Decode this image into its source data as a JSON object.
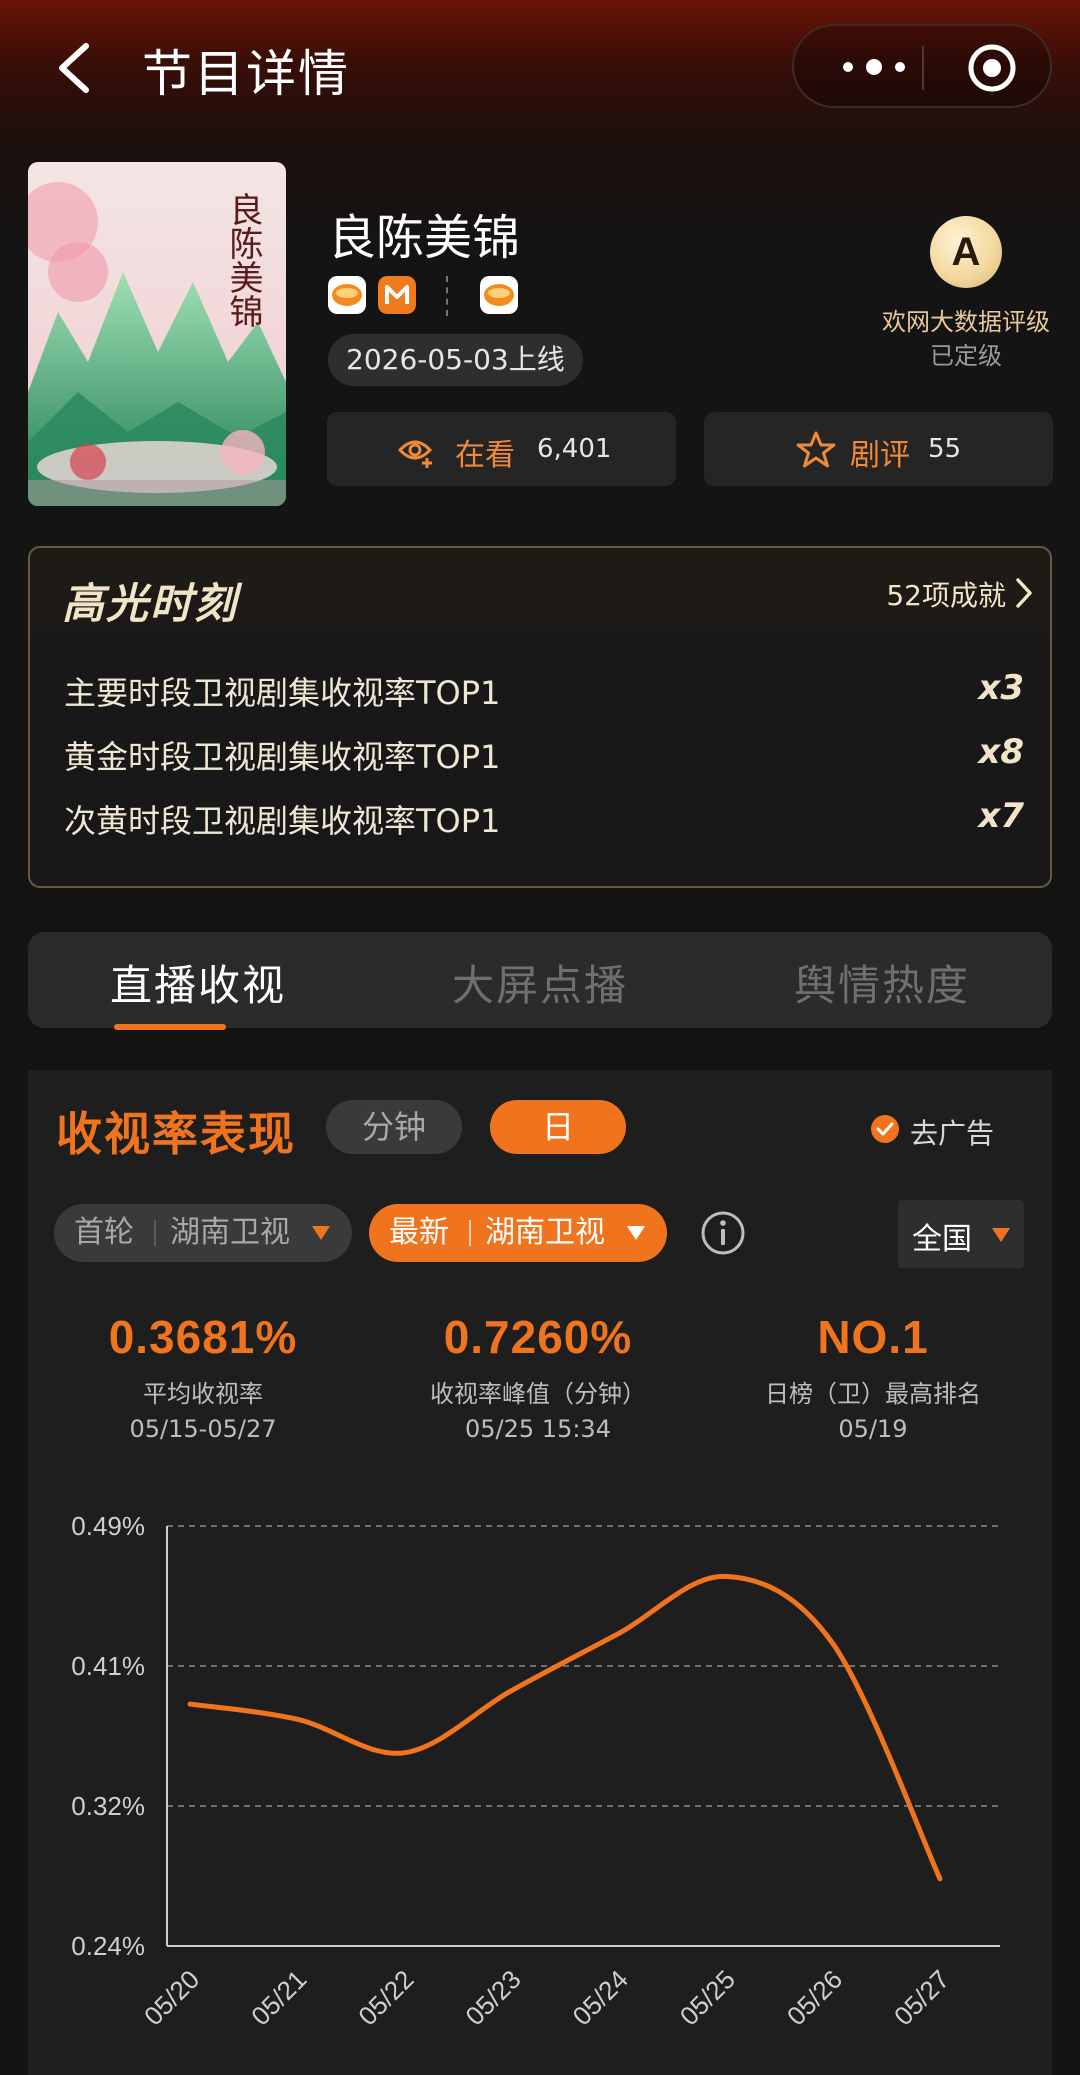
{
  "header": {
    "title": "节目详情"
  },
  "show": {
    "title": "良陈美锦",
    "release": "2026-05-03上线",
    "poster_text": "良陈美锦",
    "rating": {
      "grade": "A",
      "label": "欢网大数据评级",
      "status": "已定级"
    },
    "watching": {
      "label": "在看",
      "count": "6,401"
    },
    "reviews": {
      "label": "剧评",
      "count": "55"
    }
  },
  "highlights": {
    "title": "高光时刻",
    "count": "52项成就",
    "items": [
      {
        "text": "主要时段卫视剧集收视率TOP1",
        "times": "x3"
      },
      {
        "text": "黄金时段卫视剧集收视率TOP1",
        "times": "x8"
      },
      {
        "text": "次黄时段卫视剧集收视率TOP1",
        "times": "x7"
      }
    ]
  },
  "tabs": [
    "直播收视",
    "大屏点播",
    "舆情热度"
  ],
  "section": {
    "title": "收视率表现",
    "seg_minute": "分钟",
    "seg_day": "日",
    "ad_free": "去广告",
    "filter_first": {
      "a": "首轮",
      "b": "湖南卫视"
    },
    "filter_latest": {
      "a": "最新",
      "b": "湖南卫视"
    },
    "region": "全国"
  },
  "kpis": [
    {
      "value": "0.3681%",
      "label": "平均收视率",
      "date": "05/15-05/27"
    },
    {
      "value": "0.7260%",
      "label": "收视率峰值（分钟）",
      "date": "05/25 15:34"
    },
    {
      "value": "NO.1",
      "label": "日榜（卫）最高排名",
      "date": "05/19"
    }
  ],
  "colors": {
    "accent": "#f0741e",
    "gold": "#f2e4c6",
    "background": "#141414"
  },
  "chart_data": {
    "type": "line",
    "x": [
      "05/20",
      "05/21",
      "05/22",
      "05/23",
      "05/24",
      "05/25",
      "05/26",
      "05/27"
    ],
    "series": [
      {
        "values": [
          0.384,
          0.375,
          0.355,
          0.392,
          0.426,
          0.46,
          0.42,
          0.28
        ]
      }
    ],
    "y_ticks": [
      "0.49%",
      "0.41%",
      "0.32%",
      "0.24%"
    ],
    "ylim": [
      0.24,
      0.49
    ],
    "grid": "dashed horizontal"
  }
}
